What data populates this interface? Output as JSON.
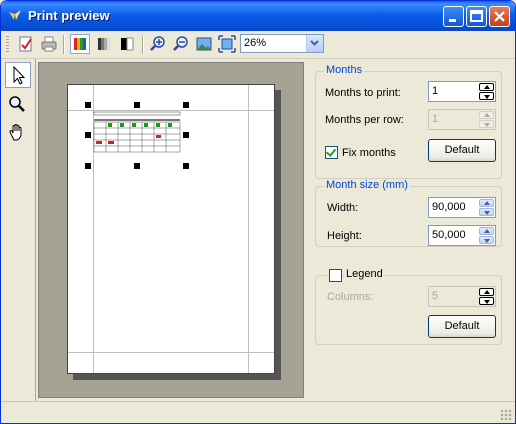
{
  "window": {
    "title": "Print preview",
    "icons": {
      "app": "print-preview-app-icon",
      "minimize": "minimize-icon",
      "maximize": "maximize-icon",
      "close": "close-icon"
    }
  },
  "toolbar": {
    "items": [
      "page-setup-icon",
      "print-icon",
      "color-mode-icon",
      "grayscale-mode-icon",
      "black-white-mode-icon",
      "zoom-in-icon",
      "zoom-out-icon",
      "fit-image-icon",
      "fit-page-icon"
    ],
    "zoom_value": "26%"
  },
  "left_tools": {
    "items": [
      "pointer-icon",
      "zoom-tool-icon",
      "hand-pan-icon"
    ],
    "selected": "pointer-icon"
  },
  "months": {
    "title": "Months",
    "months_to_print_label": "Months to print:",
    "months_to_print_value": "1",
    "months_per_row_label": "Months per row:",
    "months_per_row_value": "1",
    "fix_months_label": "Fix months",
    "fix_months_checked": true,
    "default_label": "Default"
  },
  "month_size": {
    "title": "Month size (mm)",
    "width_label": "Width:",
    "width_value": "90,000",
    "height_label": "Height:",
    "height_value": "50,000"
  },
  "legend": {
    "label": "Legend",
    "checked": false,
    "columns_label": "Columns:",
    "columns_value": "5",
    "default_label": "Default"
  },
  "colors": {
    "accent": "#0046d5",
    "title_bar": "#0a5fe8",
    "calendar_green": "#1a9a1a",
    "calendar_red": "#d42020"
  }
}
